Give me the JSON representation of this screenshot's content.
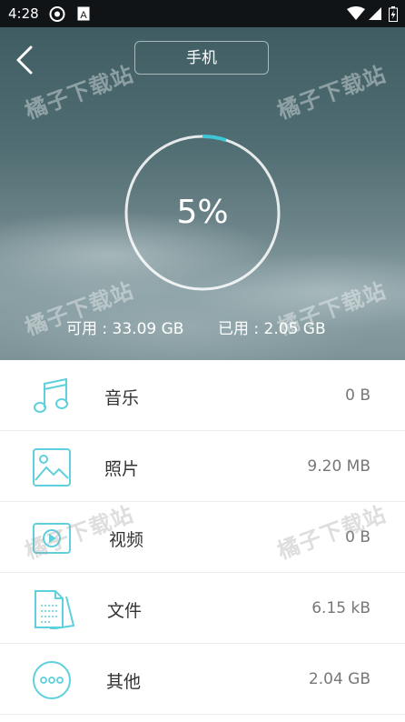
{
  "status_bar": {
    "time": "4:28",
    "icons": [
      "notification-icon",
      "font-icon",
      "wifi-icon",
      "signal-icon",
      "battery-icon"
    ]
  },
  "header": {
    "title": "手机",
    "usage_percent": "5%",
    "usage_fraction": 0.05,
    "available": "可用 : 33.09 GB",
    "used": "已用 : 2.05 GB",
    "accent": "#3ec6d6",
    "watermark": "橘子下载站"
  },
  "categories": [
    {
      "label": "音乐",
      "size": "0 B",
      "icon": "music-icon"
    },
    {
      "label": "照片",
      "size": "9.20 MB",
      "icon": "photo-icon"
    },
    {
      "label": "视频",
      "size": "0 B",
      "icon": "video-icon"
    },
    {
      "label": "文件",
      "size": "6.15 kB",
      "icon": "document-icon"
    },
    {
      "label": "其他",
      "size": "2.04 GB",
      "icon": "more-icon"
    }
  ]
}
